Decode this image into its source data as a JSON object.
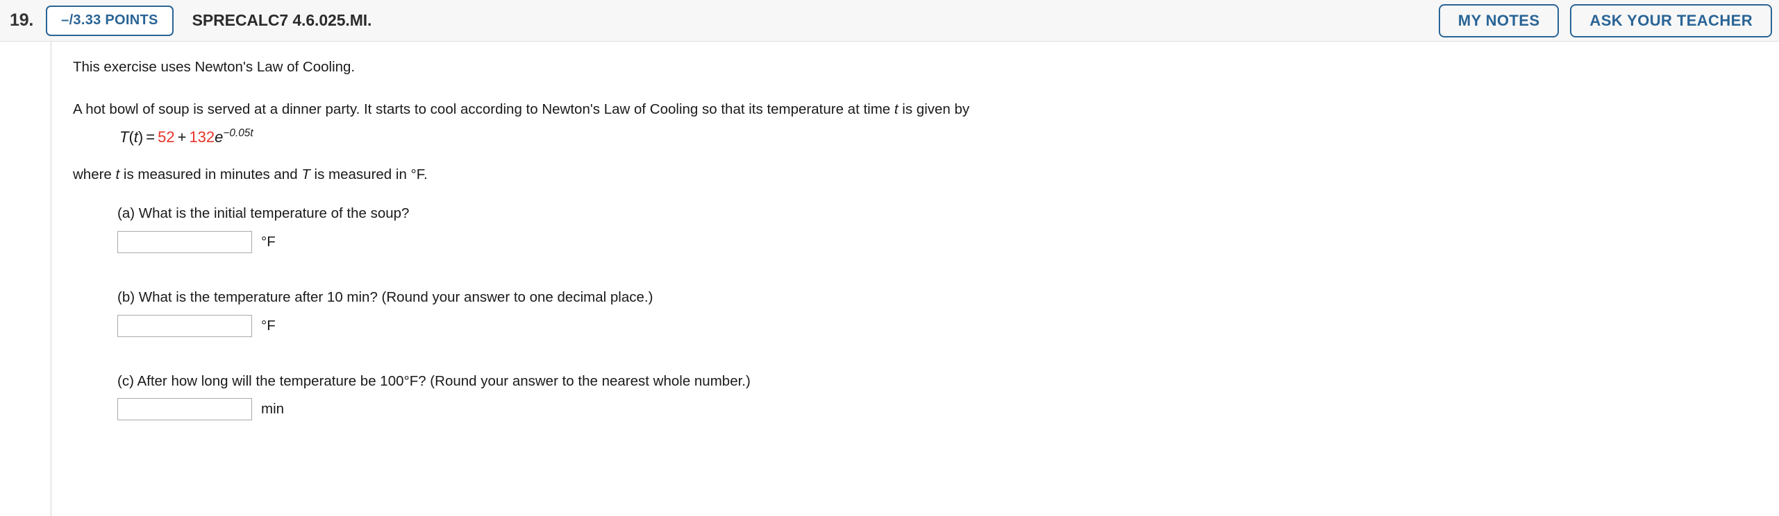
{
  "header": {
    "question_number": "19.",
    "points_badge": "–/3.33 POINTS",
    "question_code": "SPRECALC7 4.6.025.MI.",
    "my_notes_label": "MY NOTES",
    "ask_teacher_label": "ASK YOUR TEACHER",
    "accent_color": "#2a6496",
    "background_color": "#f7f7f7"
  },
  "problem": {
    "intro": "This exercise uses Newton's Law of Cooling.",
    "setup_before_var": "A hot bowl of soup is served at a dinner party. It starts to cool according to Newton's Law of Cooling so that its temperature at time ",
    "setup_var": "t",
    "setup_after_var": " is given by",
    "equation": {
      "lhs_func": "T",
      "lhs_open": "(",
      "lhs_var": "t",
      "lhs_close": ")",
      "equals": "=",
      "constant": "52",
      "plus": "+",
      "coefficient": "132",
      "base": "e",
      "exponent": "−0.05t",
      "red_color": "#e8342a"
    },
    "where_1": "where ",
    "where_var_t": "t",
    "where_2": " is measured in minutes and ",
    "where_var_T": "T",
    "where_3": " is measured in °F."
  },
  "parts": [
    {
      "prompt": "(a) What is the initial temperature of the soup?",
      "answer_value": "",
      "answer_placeholder": "",
      "unit": "°F"
    },
    {
      "prompt": "(b) What is the temperature after 10 min? (Round your answer to one decimal place.)",
      "answer_value": "",
      "answer_placeholder": "",
      "unit": "°F"
    },
    {
      "prompt": "(c) After how long will the temperature be 100°F? (Round your answer to the nearest whole number.)",
      "answer_value": "",
      "answer_placeholder": "",
      "unit": "min"
    }
  ]
}
